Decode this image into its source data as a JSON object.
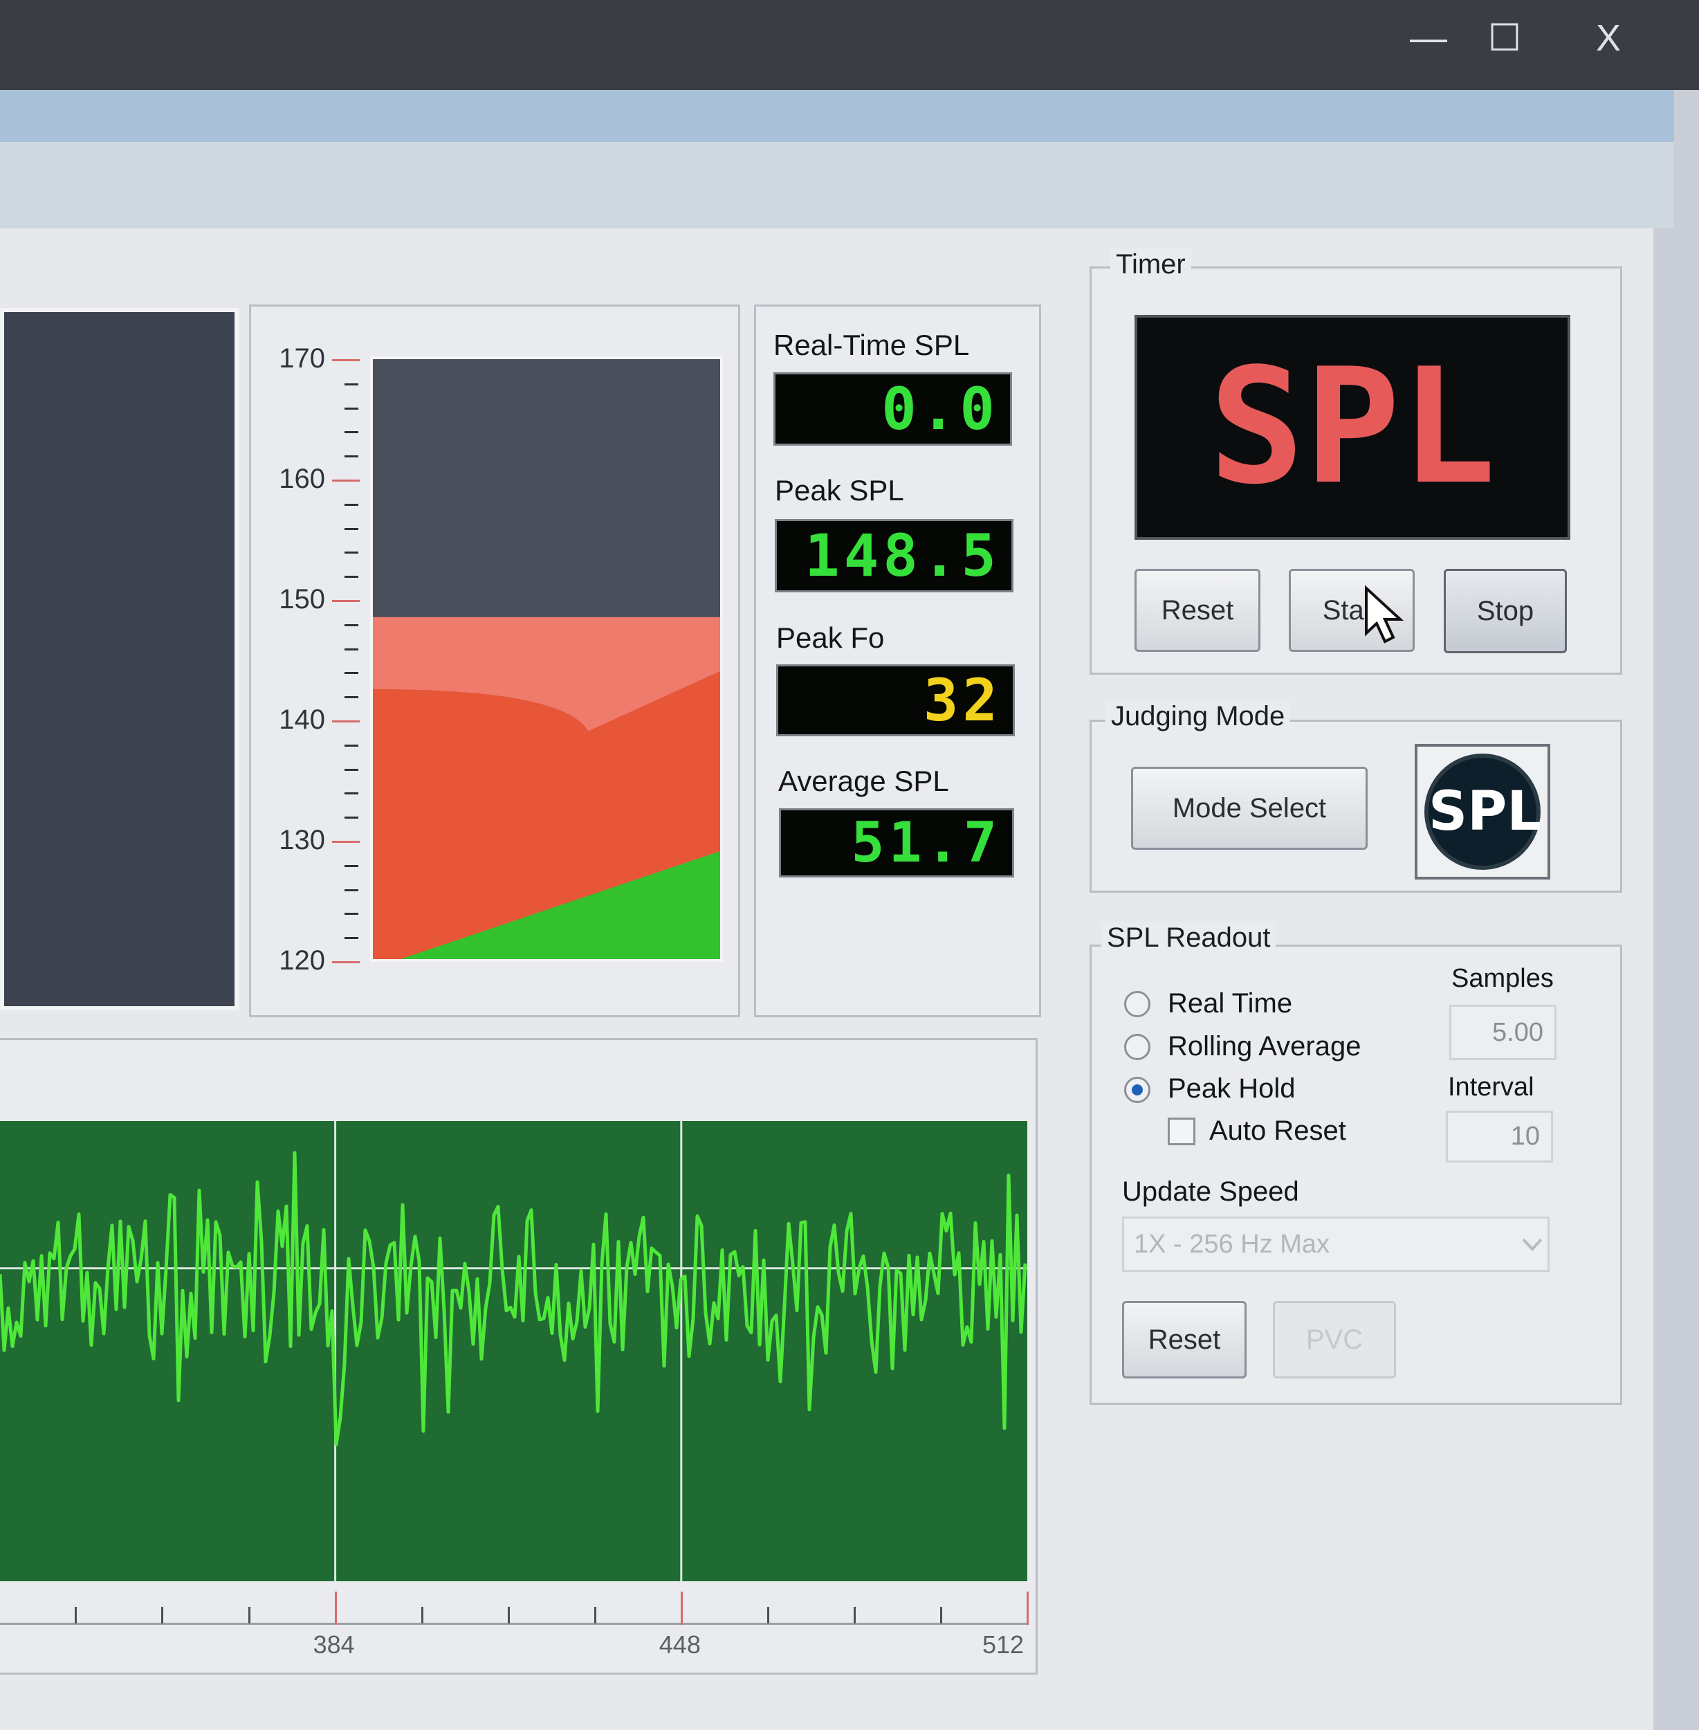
{
  "window": {
    "minimize_glyph": "—",
    "maximize_glyph": "☐",
    "close_glyph": "X"
  },
  "meter": {
    "y_ticks": [
      {
        "label": "170",
        "value": 170
      },
      {
        "label": "160",
        "value": 160
      },
      {
        "label": "150",
        "value": 150
      },
      {
        "label": "140",
        "value": 140
      },
      {
        "label": "130",
        "value": 130
      },
      {
        "label": "120",
        "value": 120
      }
    ],
    "y_range": [
      120,
      170
    ],
    "level_value": 148.5
  },
  "readouts": {
    "realtime_label": "Real-Time SPL",
    "realtime_value": "0.0",
    "peak_spl_label": "Peak SPL",
    "peak_spl_value": "148.5",
    "peak_fo_label": "Peak Fo",
    "peak_fo_value": "32",
    "average_label": "Average SPL",
    "average_value": "51.7",
    "green_color": "#36e03a",
    "yellow_color": "#f2d21c"
  },
  "timer": {
    "title": "Timer",
    "display_text": "SPL",
    "display_color": "#e65a5a",
    "reset_label": "Reset",
    "start_label": "Start",
    "stop_label": "Stop"
  },
  "judging": {
    "title": "Judging Mode",
    "mode_select_label": "Mode Select",
    "logo_text": "SPL"
  },
  "spl_readout": {
    "title": "SPL Readout",
    "options": [
      {
        "label": "Real Time",
        "selected": false
      },
      {
        "label": "Rolling Average",
        "selected": false
      },
      {
        "label": "Peak Hold",
        "selected": true
      }
    ],
    "auto_reset_label": "Auto Reset",
    "auto_reset_checked": false,
    "samples_label": "Samples",
    "samples_value": "5.00",
    "interval_label": "Interval",
    "interval_value": "10",
    "update_speed_label": "Update Speed",
    "update_speed_value": "1X - 256 Hz Max",
    "reset_label": "Reset",
    "pvc_label": "PVC"
  },
  "waveform": {
    "x_ticks": [
      {
        "label": "384",
        "value": 384
      },
      {
        "label": "448",
        "value": 448
      },
      {
        "label": "512",
        "value": 512
      }
    ],
    "x_range": [
      322,
      512
    ],
    "trace_color": "#4fe83a",
    "background_color": "#1f6b32"
  }
}
